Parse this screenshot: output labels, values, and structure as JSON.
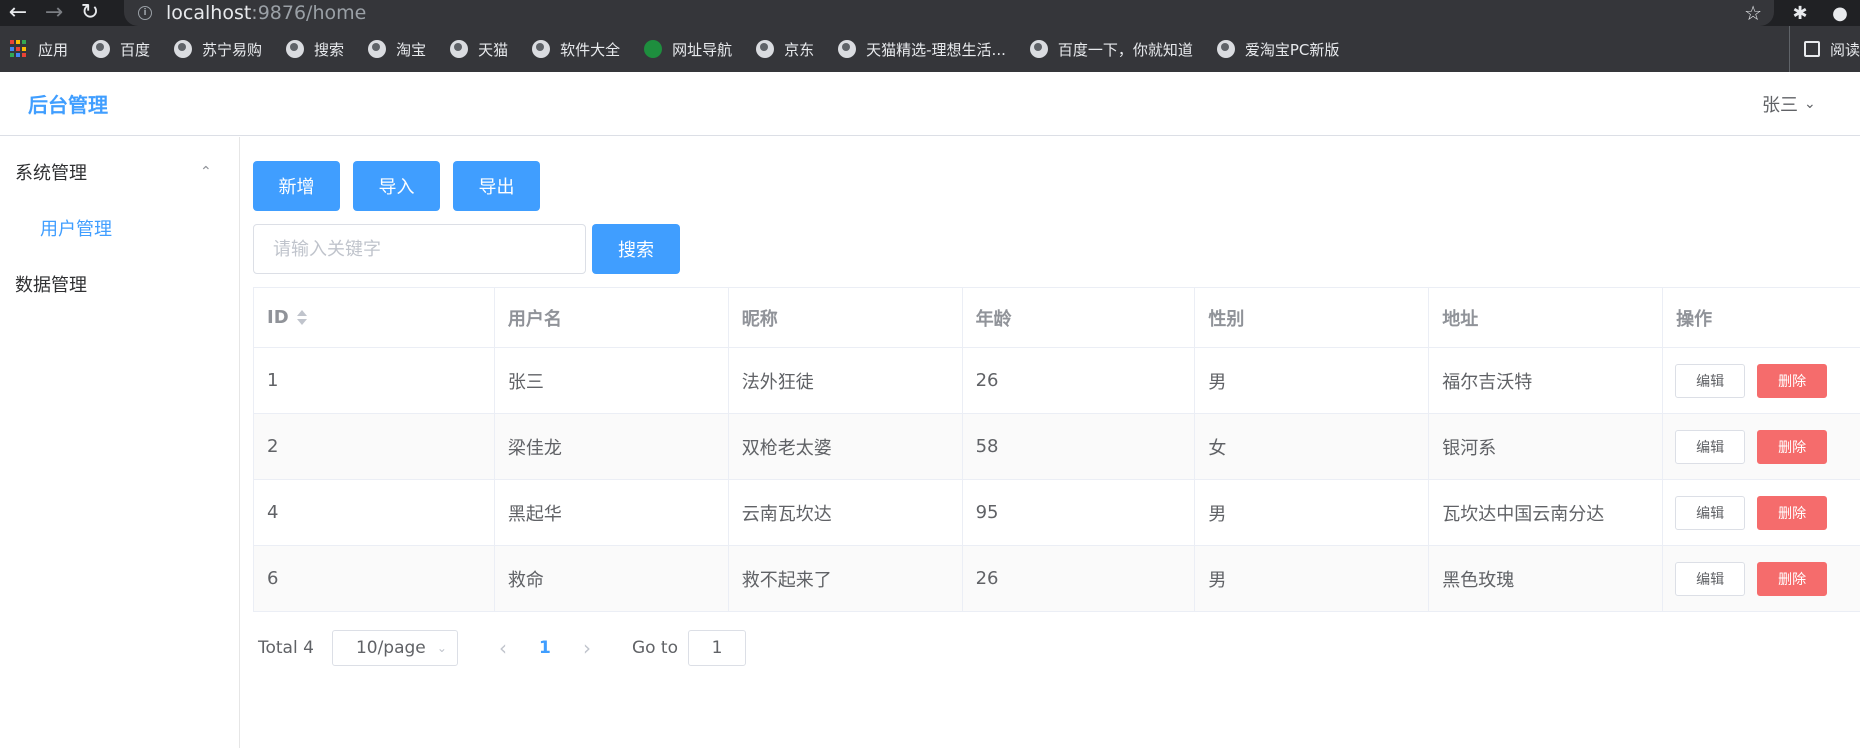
{
  "browser": {
    "url_host": "localhost",
    "url_rest": ":9876/home",
    "bookmarks": [
      "应用",
      "百度",
      "苏宁易购",
      "搜索",
      "淘宝",
      "天猫",
      "软件大全",
      "网址导航",
      "京东",
      "天猫精选-理想生活...",
      "百度一下，你就知道",
      "爱淘宝PC新版"
    ],
    "reading_list": "阅读"
  },
  "header": {
    "title": "后台管理",
    "user": "张三"
  },
  "sidebar": {
    "groups": [
      {
        "label": "系统管理",
        "items": [
          {
            "label": "用户管理"
          }
        ]
      },
      {
        "label": "数据管理"
      }
    ]
  },
  "toolbar": {
    "add_label": "新增",
    "import_label": "导入",
    "export_label": "导出",
    "search_placeholder": "请输入关键字",
    "search_label": "搜索"
  },
  "table": {
    "columns": [
      "ID",
      "用户名",
      "昵称",
      "年龄",
      "性别",
      "地址",
      "操作"
    ],
    "rows": [
      {
        "id": "1",
        "username": "张三",
        "nickname": "法外狂徒",
        "age": "26",
        "gender": "男",
        "address": "福尔吉沃特"
      },
      {
        "id": "2",
        "username": "梁佳龙",
        "nickname": "双枪老太婆",
        "age": "58",
        "gender": "女",
        "address": "银河系"
      },
      {
        "id": "4",
        "username": "黑起华",
        "nickname": "云南瓦坎达",
        "age": "95",
        "gender": "男",
        "address": "瓦坎达中国云南分达"
      },
      {
        "id": "6",
        "username": "救命",
        "nickname": "救不起来了",
        "age": "26",
        "gender": "男",
        "address": "黑色玫瑰"
      }
    ],
    "edit_label": "编辑",
    "delete_label": "删除"
  },
  "pagination": {
    "total": "Total 4",
    "page_size": "10/page",
    "current_page": "1",
    "goto_label": "Go to",
    "goto_value": "1"
  },
  "colors": {
    "primary": "#409eff",
    "danger": "#f56c6c"
  }
}
